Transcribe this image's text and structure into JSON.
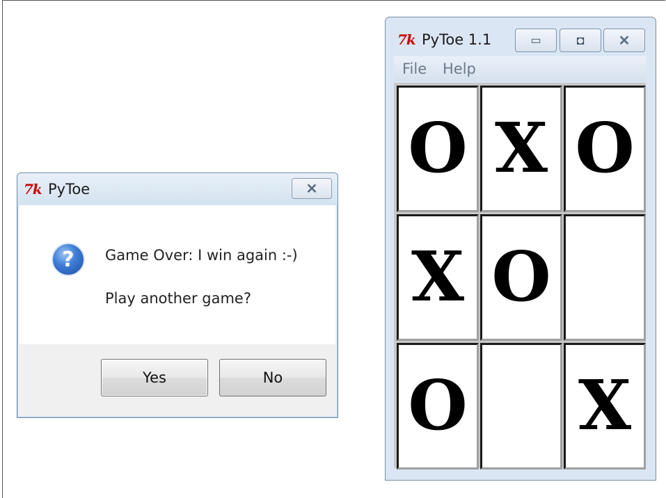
{
  "dialog": {
    "title": "PyToe",
    "logo_text": "7k",
    "close_glyph": "✕",
    "icon": "question-icon",
    "icon_glyph": "?",
    "message_line1": "Game Over: I win again :-)",
    "message_line2": "Play another game?",
    "yes_label": "Yes",
    "no_label": "No"
  },
  "game": {
    "title": "PyToe 1.1",
    "logo_text": "7k",
    "minimize_glyph": "▭",
    "maximize_glyph": "◘",
    "close_glyph": "✕",
    "menu": {
      "file": "File",
      "help": "Help"
    },
    "board": [
      [
        "O",
        "X",
        "O"
      ],
      [
        "X",
        "O",
        ""
      ],
      [
        "O",
        "",
        "X"
      ]
    ]
  }
}
